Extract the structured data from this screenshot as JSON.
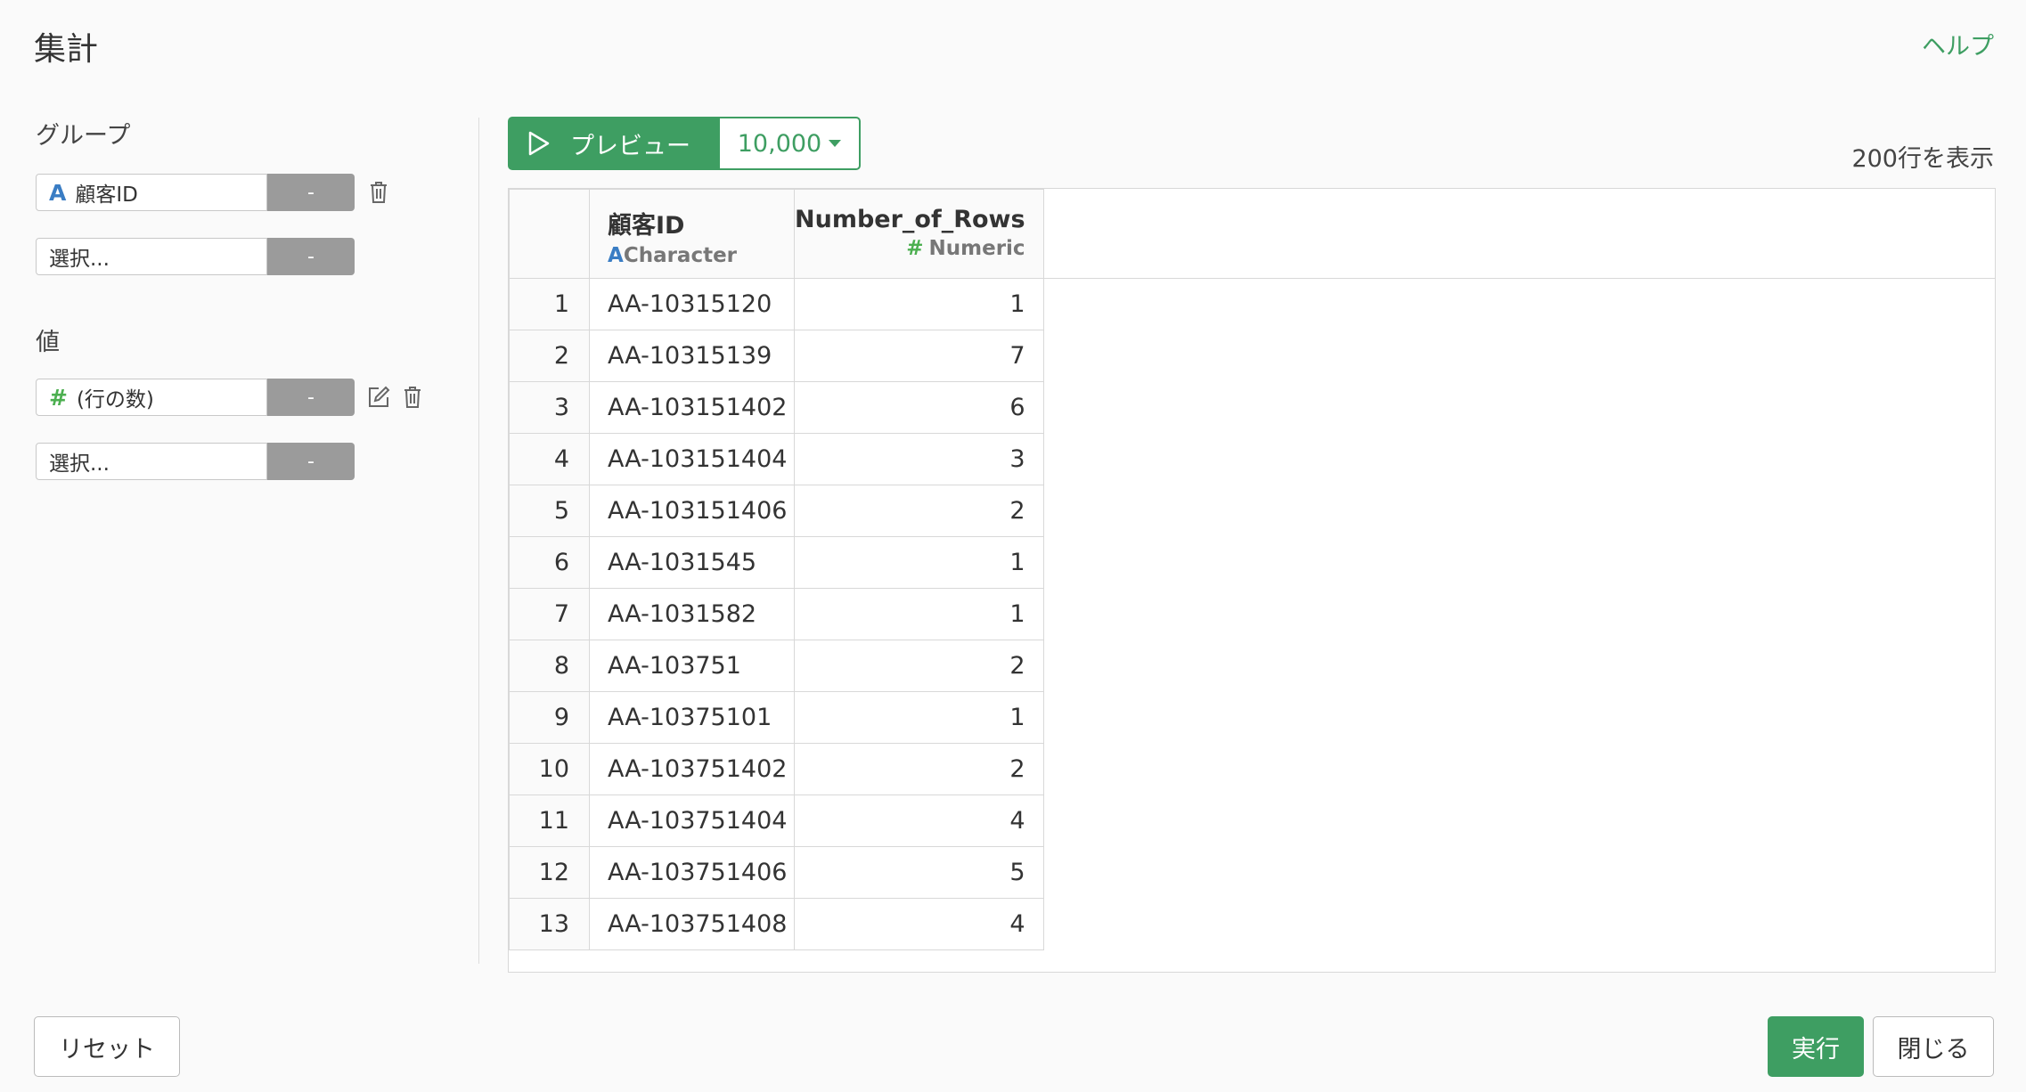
{
  "header": {
    "title": "集計",
    "help": "ヘルプ"
  },
  "group": {
    "label": "グループ",
    "items": [
      {
        "type_icon": "A",
        "column": "顧客ID",
        "agg": "-"
      },
      {
        "column": "選択...",
        "agg": "-"
      }
    ]
  },
  "values": {
    "label": "値",
    "items": [
      {
        "type_icon": "#",
        "column": "(行の数)",
        "agg": "-"
      },
      {
        "column": "選択...",
        "agg": "-"
      }
    ]
  },
  "preview": {
    "label": "プレビュー",
    "rows": "10,000",
    "showing": "200行を表示"
  },
  "table": {
    "columns": [
      {
        "name": "顧客ID",
        "type_icon": "A",
        "type": "Character"
      },
      {
        "name": "Number_of_Rows",
        "type_icon": "#",
        "type": "Numeric"
      }
    ],
    "rows": [
      [
        "1",
        "AA-10315120",
        "1"
      ],
      [
        "2",
        "AA-10315139",
        "7"
      ],
      [
        "3",
        "AA-103151402",
        "6"
      ],
      [
        "4",
        "AA-103151404",
        "3"
      ],
      [
        "5",
        "AA-103151406",
        "2"
      ],
      [
        "6",
        "AA-1031545",
        "1"
      ],
      [
        "7",
        "AA-1031582",
        "1"
      ],
      [
        "8",
        "AA-103751",
        "2"
      ],
      [
        "9",
        "AA-10375101",
        "1"
      ],
      [
        "10",
        "AA-103751402",
        "2"
      ],
      [
        "11",
        "AA-103751404",
        "4"
      ],
      [
        "12",
        "AA-103751406",
        "5"
      ],
      [
        "13",
        "AA-103751408",
        "4"
      ]
    ]
  },
  "footer": {
    "reset": "リセット",
    "run": "実行",
    "close": "閉じる"
  },
  "colors": {
    "accent": "#3e9e62",
    "char_type": "#3a7dc4",
    "num_type": "#4caf50"
  }
}
